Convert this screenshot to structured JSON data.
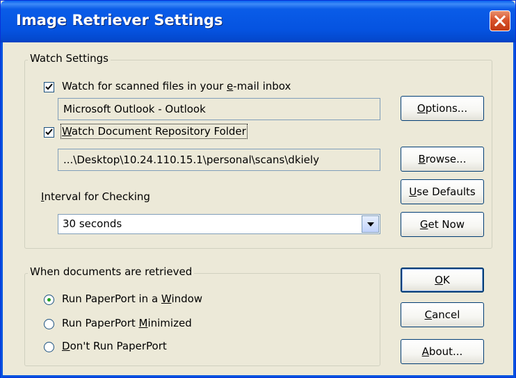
{
  "window": {
    "title": "Image Retriever Settings",
    "close_icon": "close-icon"
  },
  "watch_settings": {
    "legend": "Watch Settings",
    "email_checkbox": {
      "pre": "Watch for scanned files in your ",
      "mnemonic": "e",
      "post": "-mail inbox",
      "checked": true
    },
    "email_client": "Microsoft Outlook - Outlook",
    "options_button": {
      "mnemonic": "O",
      "post": "ptions..."
    },
    "folder_checkbox": {
      "mnemonic": "W",
      "post": "atch Document Repository Folder",
      "checked": true
    },
    "folder_path": "...\\Desktop\\10.24.110.15.1\\personal\\scans\\dkiely",
    "browse_button": {
      "mnemonic": "B",
      "post": "rowse..."
    },
    "interval_label": {
      "mnemonic": "I",
      "post": "nterval for Checking"
    },
    "interval_value": "30 seconds",
    "use_defaults_button": {
      "mnemonic": "U",
      "post": "se Defaults"
    },
    "get_now_button": {
      "mnemonic": "G",
      "post": "et Now"
    }
  },
  "retrieved": {
    "legend": "When documents are retrieved",
    "options": [
      {
        "pre": "Run PaperPort in a ",
        "mnemonic": "W",
        "post": "indow",
        "selected": true
      },
      {
        "pre": "Run PaperPort ",
        "mnemonic": "M",
        "post": "inimized",
        "selected": false
      },
      {
        "pre": "",
        "mnemonic": "D",
        "post": "on't Run PaperPort",
        "selected": false
      }
    ]
  },
  "buttons": {
    "ok": {
      "mnemonic": "O",
      "post": "K"
    },
    "cancel": {
      "mnemonic": "C",
      "post": "ancel"
    },
    "about": {
      "mnemonic": "A",
      "post": "bout..."
    }
  },
  "colors": {
    "titlebar": "#0553e0",
    "checkmark": "#21a121",
    "dialog_bg": "#ece9d8"
  }
}
